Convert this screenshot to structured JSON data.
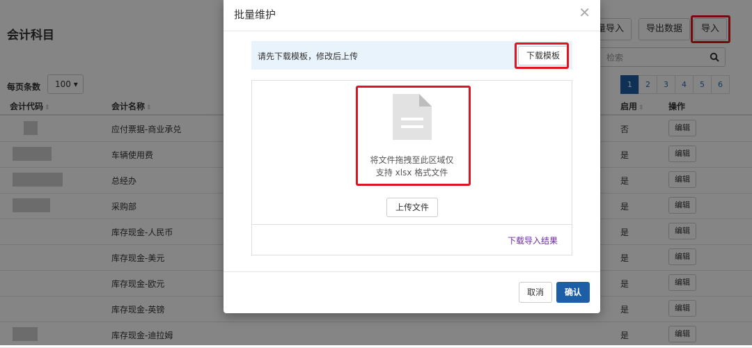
{
  "page": {
    "title": "会计科目",
    "buttons": {
      "batch_import": "量导入",
      "export": "导出数据",
      "import": "导入"
    },
    "search_placeholder": "检索",
    "pager": [
      "1",
      "2",
      "3",
      "4",
      "5",
      "6"
    ],
    "per_page_label": "每页条数",
    "per_page_value": "100 ▾",
    "columns": {
      "code": "会计代码",
      "name": "会计名称",
      "enabled": "启用",
      "action": "操作"
    },
    "rows": [
      {
        "name": "应付票据-商业承兑",
        "enabled": "否",
        "edit": "编辑"
      },
      {
        "name": "车辆使用费",
        "enabled": "是",
        "edit": "编辑"
      },
      {
        "name": "总经办",
        "enabled": "是",
        "edit": "编辑"
      },
      {
        "name": "采购部",
        "enabled": "是",
        "edit": "编辑"
      },
      {
        "name": "库存现金-人民币",
        "enabled": "是",
        "edit": "编辑"
      },
      {
        "name": "库存现金-美元",
        "enabled": "是",
        "edit": "编辑"
      },
      {
        "name": "库存现金-欧元",
        "enabled": "是",
        "edit": "编辑"
      },
      {
        "name": "库存现金-英镑",
        "enabled": "是",
        "edit": "编辑"
      },
      {
        "name": "库存现金-迪拉姆",
        "enabled": "是",
        "edit": "编辑"
      }
    ]
  },
  "modal": {
    "title": "批量维护",
    "close": "✕",
    "notice": "请先下载模板，修改后上传",
    "download_template": "下载模板",
    "drop_line1": "将文件拖拽至此区域仅",
    "drop_line2": "支持 xlsx 格式文件",
    "upload_button": "上传文件",
    "download_result": "下载导入结果",
    "cancel": "取消",
    "confirm": "确认"
  },
  "colors": {
    "primary": "#1d5fa6",
    "highlight": "#e0141e",
    "link": "#6b2c9a",
    "notice_bg": "#e9f3fb"
  }
}
